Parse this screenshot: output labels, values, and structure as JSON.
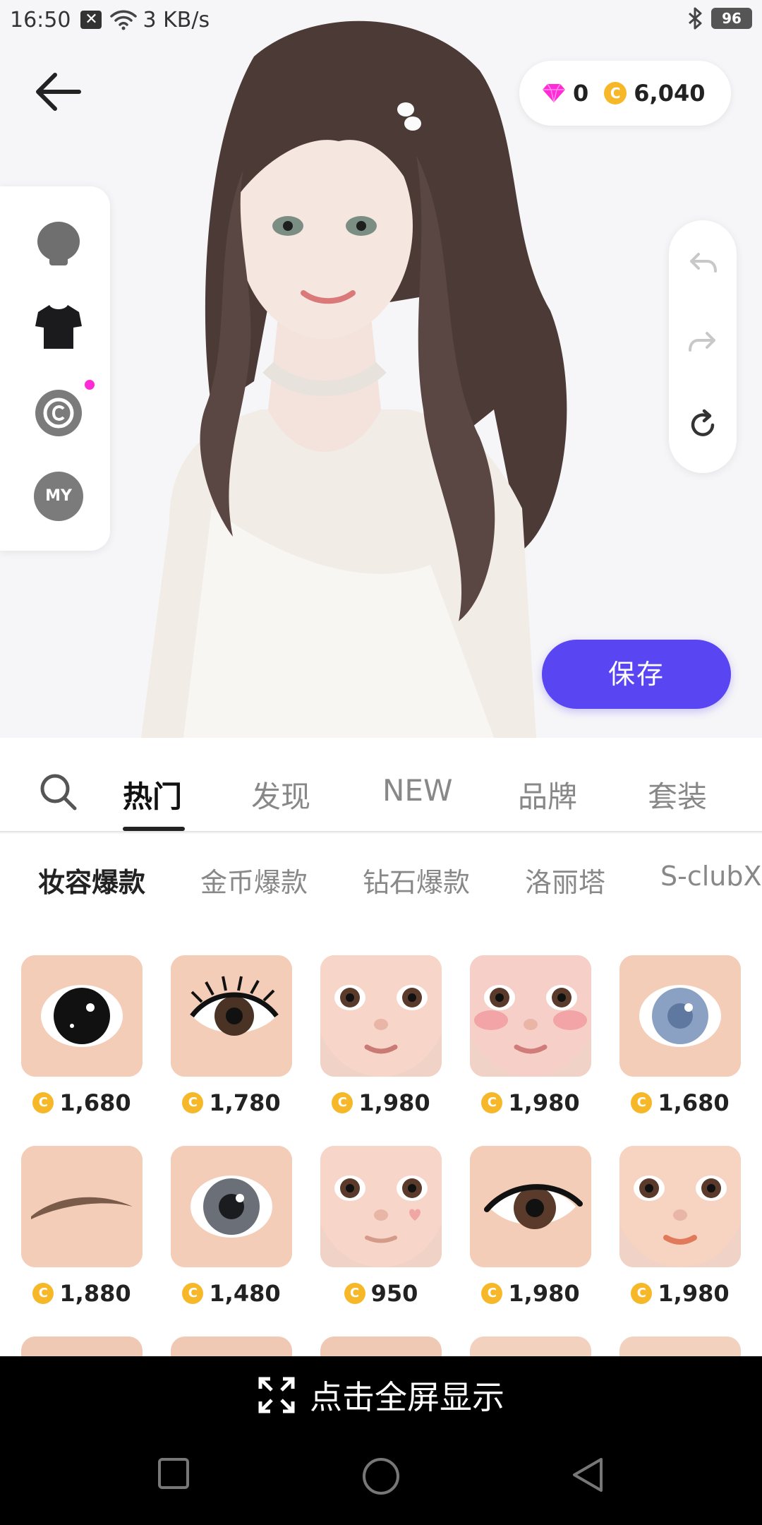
{
  "status_bar": {
    "time": "16:50",
    "network_speed": "3 KB/s",
    "battery": "96"
  },
  "header": {
    "diamonds": "0",
    "coins": "6,040"
  },
  "side_menu": {
    "my_label": "MY"
  },
  "save_label": "保存",
  "tabs": [
    "热门",
    "发现",
    "NEW",
    "品牌",
    "套装"
  ],
  "subtabs": [
    "妆容爆款",
    "金币爆款",
    "钻石爆款",
    "洛丽塔",
    "S-clubX"
  ],
  "items": [
    {
      "price": "1,680",
      "icon": "black-eye-lens"
    },
    {
      "price": "1,780",
      "icon": "eyelash-eye"
    },
    {
      "price": "1,980",
      "icon": "face-makeup"
    },
    {
      "price": "1,980",
      "icon": "face-makeup-blush"
    },
    {
      "price": "1,680",
      "icon": "blue-eye-lens"
    },
    {
      "price": "1,880",
      "icon": "eyebrow"
    },
    {
      "price": "1,480",
      "icon": "gray-eye-lens"
    },
    {
      "price": "950",
      "icon": "face-heart-sticker"
    },
    {
      "price": "1,980",
      "icon": "brown-eye-liner"
    },
    {
      "price": "1,980",
      "icon": "face-makeup-orange-lip"
    }
  ],
  "fullscreen_label": "点击全屏显示",
  "colors": {
    "accent": "#5a45f3",
    "coin": "#f6b828",
    "gem": "#ff2bd6"
  }
}
